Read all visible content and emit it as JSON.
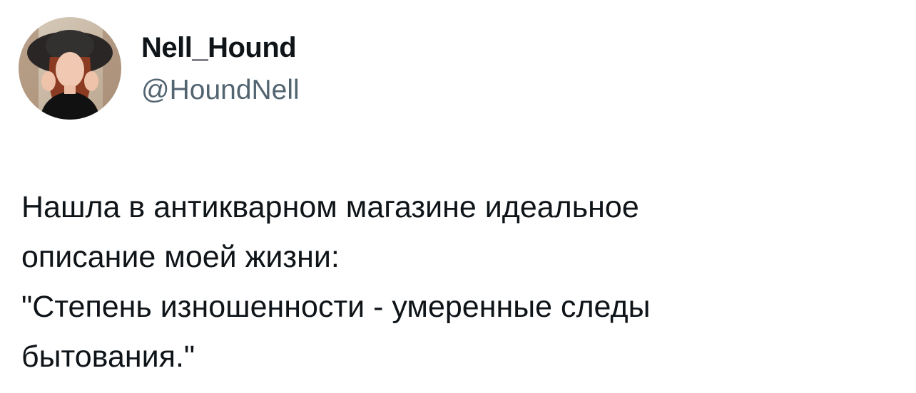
{
  "author": {
    "display_name": "Nell_Hound",
    "handle": "@HoundNell"
  },
  "tweet": {
    "lines": [
      "Нашла в антикварном магазине идеальное",
      "описание моей жизни:",
      "\"Степень изношенности - умеренные следы",
      "бытования.\""
    ]
  },
  "colors": {
    "text": "#0f1419",
    "handle": "#536471",
    "background": "#ffffff"
  }
}
